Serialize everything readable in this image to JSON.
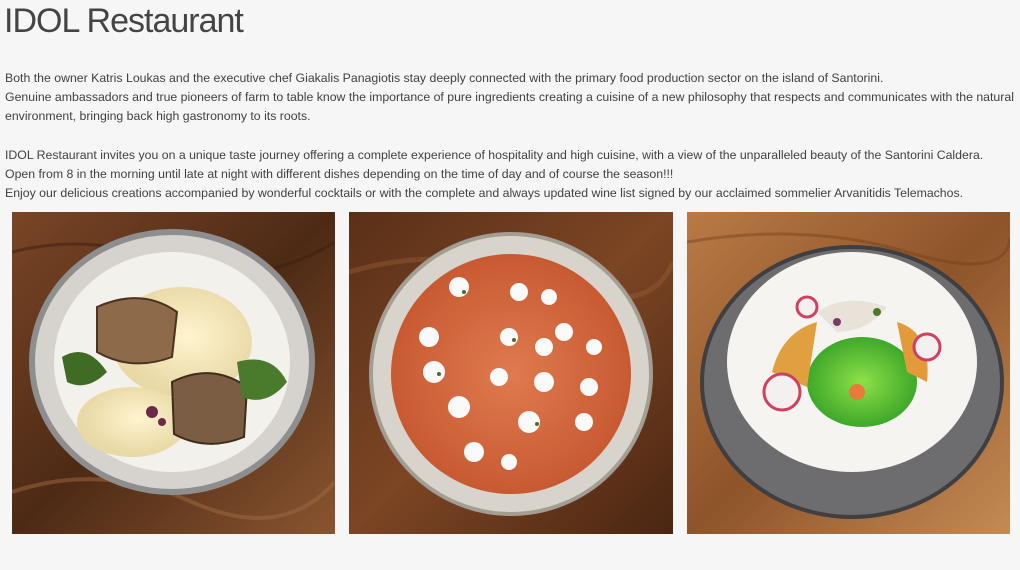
{
  "header": {
    "title": "IDOL Restaurant"
  },
  "content": {
    "lines": [
      "Both the owner Katris Loukas and the executive chef Giakalis Panagiotis stay deeply connected with the primary food production sector on the island of Santorini.",
      "Genuine ambassadors and true pioneers of farm to table know the importance of pure ingredients creating a cuisine of a new philosophy that respects and communicates with the natural",
      "environment, bringing back high gastronomy to its roots.",
      "IDOL Restaurant invites you on a unique taste journey offering a complete experience of hospitality and high cuisine, with a view of the unparalleled beauty of the Santorini Caldera.",
      "Open from 8 in the morning until late at night with different dishes depending on the time of day and of course the season!!!",
      "Enjoy our delicious creations accompanied by wonderful cocktails or with the complete and always updated wine list signed by our acclaimed sommelier Arvanitidis Telemachos."
    ]
  },
  "gallery": {
    "photos": [
      {
        "icon": "fish-dish-photo"
      },
      {
        "icon": "orzo-dish-photo"
      },
      {
        "icon": "ceviche-dish-photo"
      }
    ]
  },
  "colors": {
    "background": "#f6f6f6",
    "text": "#404040",
    "wood": "#6b3a1f"
  }
}
